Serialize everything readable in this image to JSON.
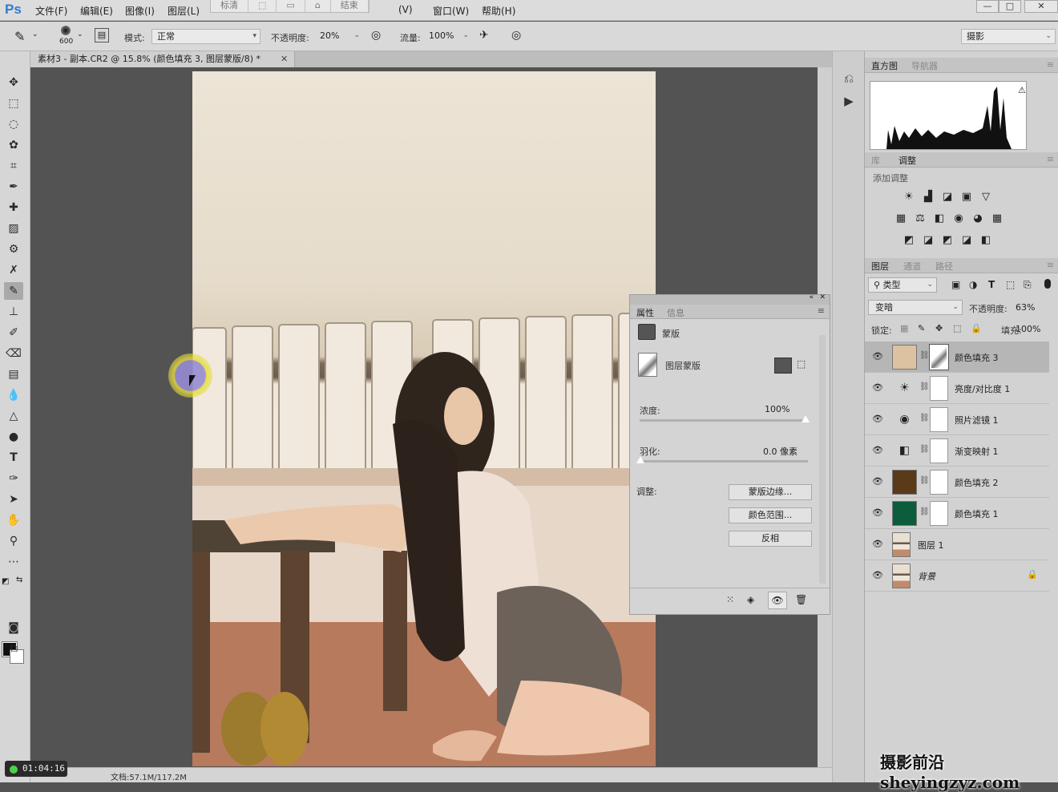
{
  "app": {
    "logo": "Ps"
  },
  "menu": [
    "文件(F)",
    "编辑(E)",
    "图像(I)",
    "图层(L)",
    "(V)",
    "窗口(W)",
    "帮助(H)"
  ],
  "workspace_buttons": [
    "标清",
    "",
    "",
    "",
    "结束"
  ],
  "window_controls": {
    "minimize": "—",
    "maximize": "□",
    "close": "✕"
  },
  "options": {
    "brush_size": "600",
    "mode_label": "模式:",
    "mode_value": "正常",
    "opacity_label": "不透明度:",
    "opacity_value": "20%",
    "flow_label": "流量:",
    "flow_value": "100%",
    "workspace": "摄影"
  },
  "document": {
    "tab_title": "素材3 - 副本.CR2 @ 15.8% (颜色填充 3, 图层蒙版/8) *",
    "close": "✕"
  },
  "status": {
    "zoom": "15.84%",
    "doc": "文档:57.1M/117.2M"
  },
  "timer": "01:04:16",
  "panels": {
    "top_tabs": [
      "直方图",
      "导航器"
    ],
    "mid_tabs": [
      "库",
      "调整"
    ],
    "adjust_title": "添加调整",
    "adjust_icons": [
      [
        "☀",
        "▟",
        "◪",
        "▣",
        "▽"
      ],
      [
        "▦",
        "⚖",
        "◧",
        "◉",
        "◕",
        "▦"
      ],
      [
        "◩",
        "◪",
        "◩",
        "◪",
        "◧"
      ]
    ],
    "layer_tabs": [
      "图层",
      "通道",
      "路径"
    ],
    "filter_kind": "类型",
    "blend_mode": "变暗",
    "opacity_label": "不透明度:",
    "opacity_value": "63%",
    "lock_label": "锁定:",
    "fill_label": "填充:",
    "fill_value": "100%"
  },
  "layers": [
    {
      "name": "颜色填充",
      "num": "3",
      "type": "fill",
      "color": "#dcc2a0",
      "selected": true
    },
    {
      "name": "亮度/对比度",
      "num": "1",
      "type": "adj",
      "icon": "☀"
    },
    {
      "name": "照片滤镜",
      "num": "1",
      "type": "adj",
      "icon": "◉"
    },
    {
      "name": "渐变映射",
      "num": "1",
      "type": "adj",
      "icon": "◧"
    },
    {
      "name": "颜色填充",
      "num": "2",
      "type": "fill",
      "color": "#5b3a19"
    },
    {
      "name": "颜色填充",
      "num": "1",
      "type": "fill",
      "color": "#0d5c3c"
    },
    {
      "name": "图层",
      "num": "1",
      "type": "img"
    },
    {
      "name": "背景",
      "num": "",
      "type": "img",
      "locked": true
    }
  ],
  "properties": {
    "tabs": [
      "属性",
      "信息"
    ],
    "section": "蒙版",
    "layer_mask": "图层蒙版",
    "density_label": "浓度:",
    "density_value": "100%",
    "feather_label": "羽化:",
    "feather_value": "0.0 像素",
    "adjust_label": "调整:",
    "buttons": [
      "蒙版边缘...",
      "颜色范围...",
      "反相"
    ]
  },
  "watermark": "摄影前沿sheyingzyz.com"
}
